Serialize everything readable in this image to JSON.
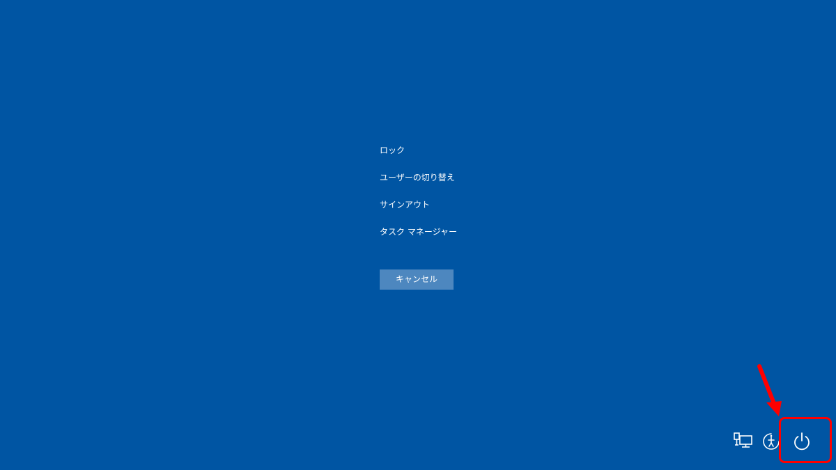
{
  "menu": {
    "items": [
      {
        "label": "ロック"
      },
      {
        "label": "ユーザーの切り替え"
      },
      {
        "label": "サインアウト"
      },
      {
        "label": "タスク マネージャー"
      }
    ]
  },
  "cancel_button": {
    "label": "キャンセル"
  },
  "tray": {
    "icons": [
      "network-icon",
      "ease-of-access-icon",
      "power-icon"
    ]
  },
  "colors": {
    "background": "#0055A3",
    "button": "#4D87BF",
    "text": "#FFFFFF",
    "annotation": "#FF0000"
  }
}
